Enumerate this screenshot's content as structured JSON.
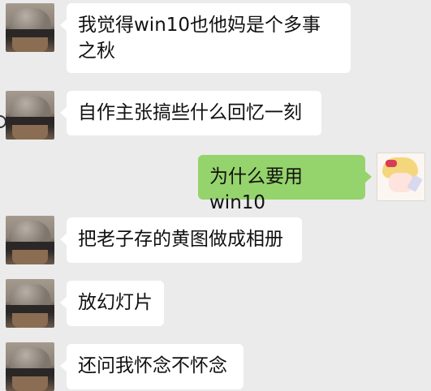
{
  "messages": [
    {
      "side": "left",
      "text_lines": [
        "我觉得win10也他妈是个多事",
        "之秋"
      ]
    },
    {
      "side": "left",
      "text": "自作主张搞些什么回忆一刻"
    },
    {
      "side": "right",
      "text": "为什么要用win10"
    },
    {
      "side": "left",
      "text": "把老子存的黄图做成相册"
    },
    {
      "side": "left",
      "text": "放幻灯片"
    },
    {
      "side": "left",
      "text": "还问我怀念不怀念"
    }
  ],
  "colors": {
    "background": "#ebebeb",
    "incoming_bubble": "#ffffff",
    "outgoing_bubble": "#95d46c"
  },
  "icons": {
    "left_avatar": "capped-man-avatar",
    "right_avatar": "anime-girl-avatar"
  }
}
